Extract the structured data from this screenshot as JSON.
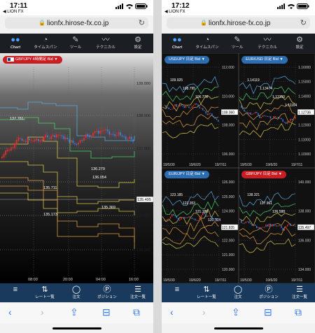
{
  "left": {
    "time": "17:11",
    "back_label": "◀ LION FX",
    "url": "lionfx.hirose-fx.co.jp",
    "tools": [
      "Chart",
      "タイムスパン",
      "ツール",
      "テクニカル",
      "設定"
    ],
    "nav": [
      "",
      "レート一覧",
      "注文",
      "ポジション",
      "注文一覧"
    ],
    "chart_title": "GBP/JPY 4時間足 Bid ▼",
    "price_ticks": [
      "139.000",
      "138.000",
      "137.000",
      "136.000",
      "135.000",
      "134.000"
    ],
    "current_price": "135.495",
    "time_ticks": [
      "08:00",
      "20:00",
      "04:00",
      "16:00"
    ],
    "labels": [
      "137.781",
      "136.279",
      "136.054",
      "135.711",
      "135.173",
      "135.369"
    ]
  },
  "right": {
    "time": "17:12",
    "back_label": "◀ LION FX",
    "url": "lionfx.hirose-fx.co.jp",
    "tools": [
      "Chart",
      "タイムスパン",
      "ツール",
      "テクニカル",
      "設定"
    ],
    "nav": [
      "",
      "レート一覧",
      "注文",
      "ポジション",
      "注文一覧"
    ],
    "panels": [
      {
        "title": "USD/JPY 日足 Bid ▼",
        "ticks": [
          "112.000",
          "110.000",
          "108.000",
          "106.000"
        ],
        "price": "108.060",
        "dates": [
          "19/5/30",
          "19/6/20",
          "19/7/11"
        ],
        "labels": [
          "109.925",
          "108.795",
          "106.778"
        ]
      },
      {
        "title": "EUR/USD 日足 Bid ▼",
        "ticks": [
          "1.16000",
          "1.15000",
          "1.14000",
          "1.13000",
          "1.12000",
          "1.11000",
          "1.10000"
        ],
        "price": "1.12736",
        "dates": [
          "19/5/30",
          "19/6/20",
          "19/7/11"
        ],
        "labels": [
          "1.14119",
          "1.13474",
          "1.12150",
          "1.11164"
        ]
      },
      {
        "title": "EUR/JPY 日足 Bid ▼",
        "ticks": [
          "126.000",
          "125.000",
          "124.000",
          "123.000",
          "122.000",
          "121.000",
          "120.000"
        ],
        "price": "121.835",
        "dates": [
          "19/5/30",
          "19/6/20",
          "19/7/11"
        ],
        "labels": [
          "123.185",
          "122.353",
          "121.188",
          "120.774"
        ]
      },
      {
        "title": "GBP/JPY 日足 Bid ▼",
        "ticks": [
          "140.000",
          "138.000",
          "136.000",
          "134.000"
        ],
        "price": "135.497",
        "dates": [
          "19/5/30",
          "19/6/20",
          "19/7/11"
        ],
        "labels": [
          "138.321",
          "137.961",
          "136.588"
        ]
      }
    ]
  },
  "colors": {
    "toolbar": "#1b1e23",
    "nav": "#1a3a5d",
    "red_pill": "#c91f24",
    "blue_pill": "#2c6db2"
  }
}
